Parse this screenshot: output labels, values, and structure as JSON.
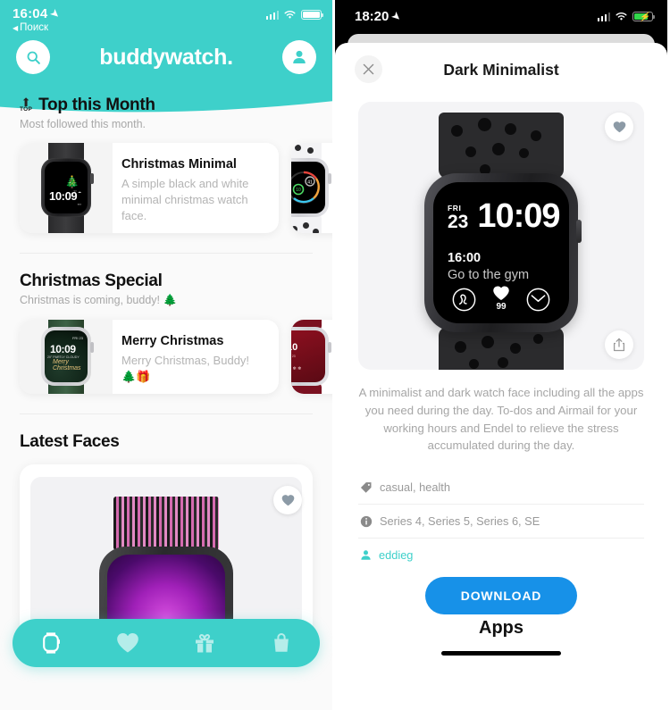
{
  "left": {
    "status": {
      "time": "16:04",
      "back_label": "Поиск",
      "location_icon": "location-arrow-icon",
      "wifi_icon": "wifi-icon",
      "battery_icon": "battery-icon"
    },
    "header": {
      "brand": "buddywatch.",
      "search_icon": "search-icon",
      "profile_icon": "person-icon",
      "accent_color": "#3ed0ca"
    },
    "sections": [
      {
        "badge": "TOP",
        "title": "Top this Month",
        "subtitle": "Most followed this month.",
        "cards": [
          {
            "name": "Christmas Minimal",
            "desc": "A simple black and white minimal christmas watch face.",
            "watch_time": "10:09"
          }
        ]
      },
      {
        "title": "Christmas Special",
        "subtitle": "Christmas is coming, buddy! 🌲",
        "cards": [
          {
            "name": "Merry Christmas",
            "desc": "Merry Christmas, Buddy! 🌲🎁",
            "watch_time": "10:09",
            "watch_weather": "20° PARTLY CLOUDY",
            "watch_date": "FRI 23"
          }
        ]
      },
      {
        "title": "Latest Faces",
        "subtitle": ""
      }
    ],
    "tabbar": {
      "items": [
        {
          "icon": "watch-icon",
          "active": true
        },
        {
          "icon": "heart-icon",
          "active": false
        },
        {
          "icon": "gift-icon",
          "active": false
        },
        {
          "icon": "shopping-bag-icon",
          "active": false
        }
      ]
    },
    "favorite_icon": "heart-icon"
  },
  "right": {
    "status": {
      "time": "18:20",
      "location_icon": "location-arrow-icon",
      "cellular_icon": "cellular-icon",
      "wifi_icon": "wifi-icon",
      "battery_icon": "battery-charging-icon"
    },
    "sheet": {
      "close_icon": "close-icon",
      "title": "Dark Minimalist",
      "favorite_icon": "heart-icon",
      "share_icon": "share-icon"
    },
    "watchface": {
      "weekday": "FRI",
      "day": "23",
      "time": "10:09",
      "event_time": "16:00",
      "event_title": "Go to the gym",
      "complications": [
        {
          "icon": "endel-icon",
          "value": ""
        },
        {
          "icon": "heart-icon",
          "value": "99"
        },
        {
          "icon": "airmail-icon",
          "value": ""
        }
      ]
    },
    "description": "A minimalist and dark watch face including all the apps you need during the day. To-dos and Airmail for your working hours and Endel to relieve the stress accumulated during the day.",
    "meta": [
      {
        "icon": "tag-icon",
        "text": "casual, health",
        "type": "tags"
      },
      {
        "icon": "info-icon",
        "text": "Series 4, Series 5, Series 6, SE",
        "type": "compatibility"
      },
      {
        "icon": "person-icon",
        "text": "eddieg",
        "type": "author"
      }
    ],
    "download_label": "DOWNLOAD",
    "apps_label": "Apps",
    "download_color": "#1791e8"
  }
}
